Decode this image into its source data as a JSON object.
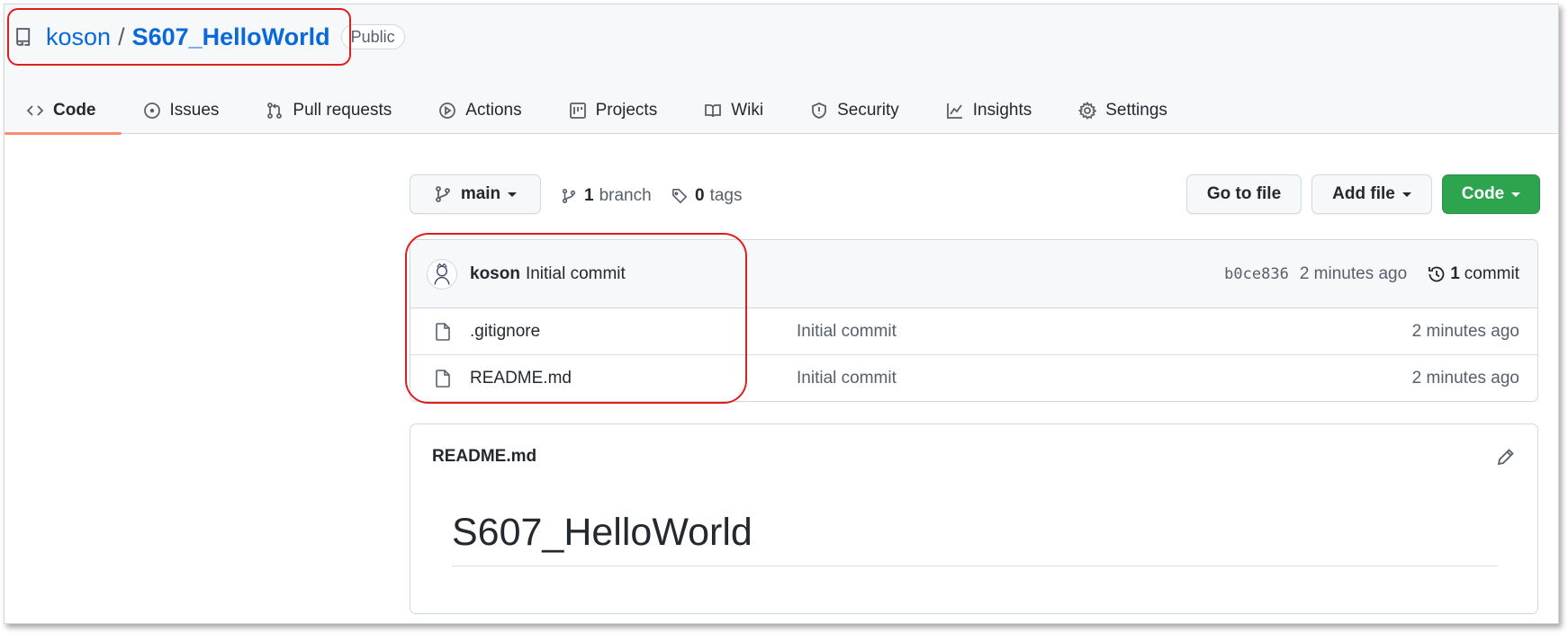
{
  "repo": {
    "owner": "koson",
    "separator": "/",
    "name": "S607_HelloWorld",
    "visibility": "Public"
  },
  "tabs": [
    {
      "label": "Code",
      "icon": "code-icon",
      "active": true
    },
    {
      "label": "Issues",
      "icon": "issue-icon"
    },
    {
      "label": "Pull requests",
      "icon": "pull-request-icon"
    },
    {
      "label": "Actions",
      "icon": "play-icon"
    },
    {
      "label": "Projects",
      "icon": "project-icon"
    },
    {
      "label": "Wiki",
      "icon": "book-icon"
    },
    {
      "label": "Security",
      "icon": "shield-icon"
    },
    {
      "label": "Insights",
      "icon": "graph-icon"
    },
    {
      "label": "Settings",
      "icon": "gear-icon"
    }
  ],
  "toolbar": {
    "branch_selector": "main",
    "branch_count": "1",
    "branch_label": "branch",
    "tag_count": "0",
    "tag_label": "tags",
    "go_to_file": "Go to file",
    "add_file": "Add file",
    "code": "Code"
  },
  "latest_commit": {
    "author": "koson",
    "message": "Initial commit",
    "sha": "b0ce836",
    "time": "2 minutes ago",
    "commit_count": "1",
    "commit_label": "commit"
  },
  "files": [
    {
      "name": ".gitignore",
      "commit": "Initial commit",
      "time": "2 minutes ago"
    },
    {
      "name": "README.md",
      "commit": "Initial commit",
      "time": "2 minutes ago"
    }
  ],
  "readme": {
    "filename": "README.md",
    "heading": "S607_HelloWorld"
  },
  "colors": {
    "link": "#0969da",
    "green_button": "#2da44e",
    "active_tab_underline": "#fd8c73",
    "annotation_red": "#e01e1e"
  }
}
